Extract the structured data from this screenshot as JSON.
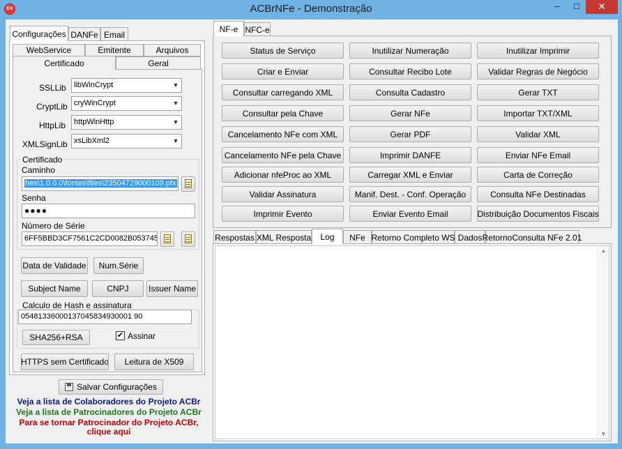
{
  "window": {
    "title": "ACBrNFe - Demonstração",
    "icon": "DX",
    "minimize": "–",
    "maximize": "□",
    "close": "✕"
  },
  "left": {
    "top_tabs": [
      "Configurações",
      "DANFe",
      "Email"
    ],
    "row_tabs_back": [
      "WebService",
      "Emitente",
      "Arquivos"
    ],
    "row_tabs_front": [
      "Certificado",
      "Geral"
    ],
    "ssllib_label": "SSLLib",
    "ssllib_value": "libWinCrypt",
    "cryptlib_label": "CryptLib",
    "cryptlib_value": "cryWinCrypt",
    "httplib_label": "HttpLib",
    "httplib_value": "httpWinHttp",
    "xmlsignlib_label": "XMLSignLib",
    "xmlsignlib_value": "xsLibXml2",
    "cert_group": "Certificado",
    "caminho_label": "Caminho",
    "caminho_value": "hes\\1.0.0.0\\fontes\\files\\23504729000109.pfx",
    "senha_label": "Senha",
    "senha_value": "●●●●",
    "serie_label": "Número de Série",
    "serie_value": "6FF5BBD3CF7561C2CD0082B0537453",
    "btn_validade": "Data de Validade",
    "btn_numserie": "Num.Série",
    "btn_subject": "Subject Name",
    "btn_cnpj": "CNPJ",
    "btn_issuer": "Issuer Name",
    "hash_group": "Calculo de Hash e assinatura",
    "hash_value": "05481336000137045834930001 90",
    "btn_sha": "SHA256+RSA",
    "assinar_label": "Assinar",
    "assinar_checked": "✔",
    "btn_https": "HTTPS sem Certificado",
    "btn_x509": "Leitura de X509",
    "btn_salvar": "Salvar Configurações",
    "link_colab": "Veja a lista de Colaboradores do Projeto ACBr",
    "link_patro": "Veja a lista de Patrocinadores do Projeto ACBr",
    "link_tornar1": "Para se tornar Patrocinador do Projeto ACBr,",
    "link_tornar2": "clique aqui",
    "colors": {
      "blue": "#0a1a8c",
      "green": "#1a7a1a",
      "red": "#cc0000"
    }
  },
  "right": {
    "tabs": [
      "NF-e",
      "NFC-e"
    ],
    "buttons": [
      "Status de Serviço",
      "Inutilizar Numeração",
      "Inutilizar Imprimir",
      "Criar e Enviar",
      "Consultar Recibo Lote",
      "Validar Regras de Negócio",
      "Consultar carregando XML",
      "Consulta Cadastro",
      "Gerar TXT",
      "Consultar pela Chave",
      "Gerar NFe",
      "Importar TXT/XML",
      "Cancelamento NFe com XML",
      "Gerar PDF",
      "Validar XML",
      "Cancelamento NFe pela Chave",
      "Imprimir DANFE",
      "Enviar NFe Email",
      "Adicionar nfeProc ao XML",
      "Carregar XML e Enviar",
      "Carta de Correção",
      "Validar Assinatura",
      "Manif. Dest. - Conf. Operação",
      "Consulta NFe Destinadas",
      "Imprimir Evento",
      "Enviar Evento Email",
      "Distribuição Documentos Fiscais"
    ],
    "bottom_tabs": [
      "Respostas",
      "XML Resposta",
      "Log",
      "NFe",
      "Retorno Completo WS",
      "Dados",
      "RetornoConsulta NFe 2.01"
    ]
  }
}
